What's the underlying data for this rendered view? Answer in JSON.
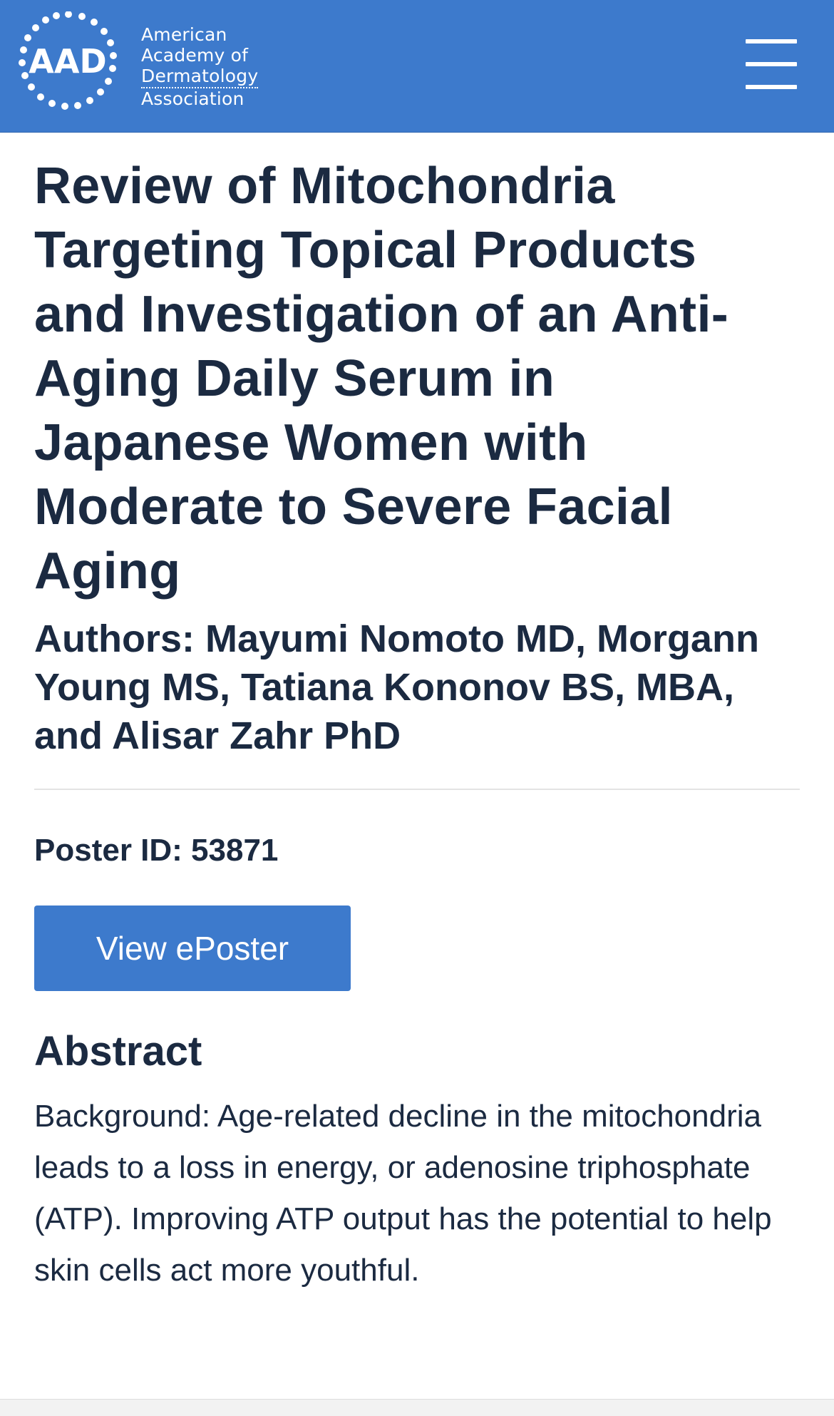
{
  "header": {
    "logo_mark": "AAD",
    "logo_lines": [
      "American",
      "Academy of",
      "Dermatology",
      "Association"
    ],
    "menu_icon": "hamburger-menu-icon",
    "background_color": "#3d7acc"
  },
  "article": {
    "title": "Review of Mitochondria Targeting Topical Products and Investigation of an Anti-Aging Daily Serum in Japanese Women with Moderate to Severe Facial Aging",
    "authors": "Authors: Mayumi Nomoto MD, Morgann Young MS, Tatiana Kononov BS, MBA, and Alisar Zahr PhD",
    "poster_id": "Poster ID: 53871",
    "view_button_label": "View ePoster",
    "abstract_heading": "Abstract",
    "abstract_text": "Background: Age-related decline in the mitochondria leads to a loss in energy, or adenosine triphosphate (ATP). Improving ATP output has the potential to help skin cells act more youthful."
  },
  "colors": {
    "accent": "#3d7acc",
    "text": "#1b2a41"
  }
}
